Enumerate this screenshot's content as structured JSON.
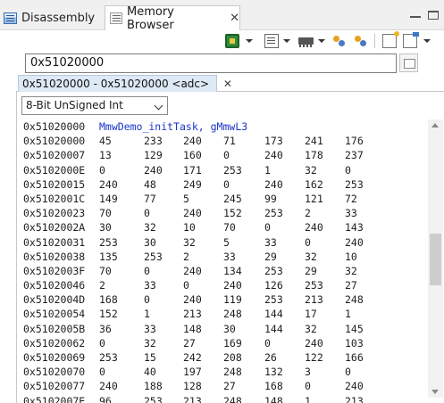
{
  "tabs": [
    {
      "label": "Disassembly"
    },
    {
      "label": "Memory Browser"
    }
  ],
  "address_input": "0x51020000",
  "rendering_tab": {
    "label": "0x51020000 - 0x51020000  <adc>"
  },
  "format_select": "8-Bit UnSigned Int",
  "header_row": {
    "address": "0x51020000",
    "label": "MmwDemo_initTask, gMmwL3"
  },
  "rows": [
    {
      "address": "0x51020000",
      "values": [
        "45",
        "233",
        "240",
        "71",
        "173",
        "241",
        "176"
      ]
    },
    {
      "address": "0x51020007",
      "values": [
        "13",
        "129",
        "160",
        "0",
        "240",
        "178",
        "237"
      ]
    },
    {
      "address": "0x5102000E",
      "values": [
        "0",
        "240",
        "171",
        "253",
        "1",
        "32",
        "0"
      ]
    },
    {
      "address": "0x51020015",
      "values": [
        "240",
        "48",
        "249",
        "0",
        "240",
        "162",
        "253"
      ]
    },
    {
      "address": "0x5102001C",
      "values": [
        "149",
        "77",
        "5",
        "245",
        "99",
        "121",
        "72"
      ]
    },
    {
      "address": "0x51020023",
      "values": [
        "70",
        "0",
        "240",
        "152",
        "253",
        "2",
        "33"
      ]
    },
    {
      "address": "0x5102002A",
      "values": [
        "30",
        "32",
        "10",
        "70",
        "0",
        "240",
        "143"
      ]
    },
    {
      "address": "0x51020031",
      "values": [
        "253",
        "30",
        "32",
        "5",
        "33",
        "0",
        "240"
      ]
    },
    {
      "address": "0x51020038",
      "values": [
        "135",
        "253",
        "2",
        "33",
        "29",
        "32",
        "10"
      ]
    },
    {
      "address": "0x5102003F",
      "values": [
        "70",
        "0",
        "240",
        "134",
        "253",
        "29",
        "32"
      ]
    },
    {
      "address": "0x51020046",
      "values": [
        "2",
        "33",
        "0",
        "240",
        "126",
        "253",
        "27"
      ]
    },
    {
      "address": "0x5102004D",
      "values": [
        "168",
        "0",
        "240",
        "119",
        "253",
        "213",
        "248"
      ]
    },
    {
      "address": "0x51020054",
      "values": [
        "152",
        "1",
        "213",
        "248",
        "144",
        "17",
        "1"
      ]
    },
    {
      "address": "0x5102005B",
      "values": [
        "36",
        "33",
        "148",
        "30",
        "144",
        "32",
        "145"
      ]
    },
    {
      "address": "0x51020062",
      "values": [
        "0",
        "32",
        "27",
        "169",
        "0",
        "240",
        "103"
      ]
    },
    {
      "address": "0x51020069",
      "values": [
        "253",
        "15",
        "242",
        "208",
        "26",
        "122",
        "166"
      ]
    },
    {
      "address": "0x51020070",
      "values": [
        "0",
        "40",
        "197",
        "248",
        "132",
        "3",
        "0"
      ]
    },
    {
      "address": "0x51020077",
      "values": [
        "240",
        "188",
        "128",
        "27",
        "168",
        "0",
        "240"
      ]
    },
    {
      "address": "0x5102007E",
      "values": [
        "96",
        "253",
        "213",
        "248",
        "148",
        "1",
        "213"
      ]
    }
  ],
  "icons": {
    "tab_disassembly": "disassembly-icon",
    "tab_memory": "memory-browser-icon",
    "toolbar": [
      "connect-chip-icon",
      "load-memory-icon",
      "memory-ram-icon",
      "link-icon",
      "sync-icon",
      "new-tab-icon",
      "pin-icon"
    ]
  },
  "colors": {
    "label": "#1a35c8",
    "tab_active": "#ffffff",
    "rendering_tab": "#dde9f5"
  }
}
